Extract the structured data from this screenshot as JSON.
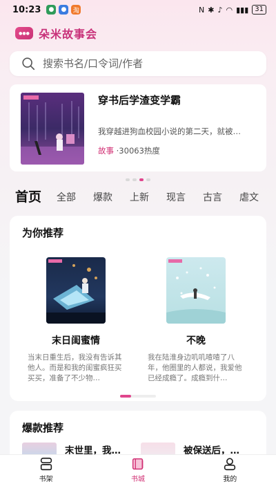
{
  "status": {
    "time": "10:23",
    "battery": "31"
  },
  "header": {
    "title": "朵米故事会"
  },
  "search": {
    "placeholder": "搜索书名/口令词/作者"
  },
  "banner": {
    "title": "穿书后学渣变学霸",
    "desc": "我穿越进狗血校园小说的第二天，就被…",
    "category": "故事",
    "heat": "·30063热度"
  },
  "tabs": [
    {
      "label": "首页",
      "active": true
    },
    {
      "label": "全部"
    },
    {
      "label": "爆款"
    },
    {
      "label": "上新"
    },
    {
      "label": "现言"
    },
    {
      "label": "古言"
    },
    {
      "label": "虐文"
    }
  ],
  "recommend": {
    "title": "为你推荐",
    "books": [
      {
        "name": "末日闺蜜情",
        "desc": "当末日重生后，我没有告诉其他人。而是和我的闺蜜疯狂买买买，准备了不少物…"
      },
      {
        "name": "不晚",
        "desc": "我在陆淮身边叽叽喳喳了八年，他圈里的人都说，我爱他已经成瘾了。成瘾到什…"
      }
    ],
    "scroll_progress": 0.3
  },
  "hot": {
    "title": "爆款推荐",
    "items": [
      {
        "name": "末世里，我…"
      },
      {
        "name": "被保送后，…"
      }
    ]
  },
  "nav": [
    {
      "label": "书架",
      "icon": "bookshelf-icon"
    },
    {
      "label": "书城",
      "icon": "bookstore-icon",
      "active": true
    },
    {
      "label": "我的",
      "icon": "profile-icon"
    }
  ],
  "colors": {
    "accent": "#d13074",
    "brand": "#c8327a"
  }
}
